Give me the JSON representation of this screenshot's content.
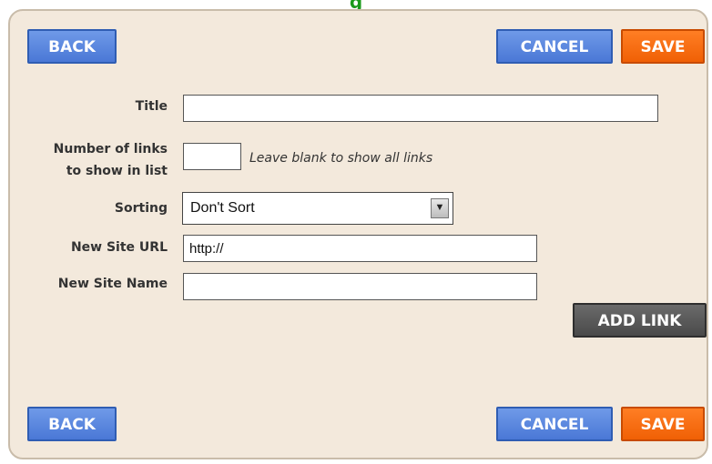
{
  "header": {
    "title_fragment": "g"
  },
  "toolbar": {
    "back_label": "BACK",
    "cancel_label": "CANCEL",
    "save_label": "SAVE"
  },
  "form": {
    "title_label": "Title",
    "title_value": "",
    "num_links_label_line1": "Number of links",
    "num_links_label_line2": "to show in list",
    "num_links_value": "",
    "num_links_hint": "Leave blank to show all links",
    "sorting_label": "Sorting",
    "sorting_selected": "Don't Sort",
    "new_site_url_label": "New Site URL",
    "new_site_url_value": "http://",
    "new_site_name_label": "New Site Name",
    "new_site_name_value": "",
    "add_link_label": "ADD LINK"
  },
  "footer": {
    "back_label": "BACK",
    "cancel_label": "CANCEL",
    "save_label": "SAVE"
  },
  "colors": {
    "panel_bg": "#f3e9dc",
    "blue_button": "#5a86df",
    "orange_button": "#f26a0f",
    "dark_button": "#555555",
    "title_green": "#1a9a1a"
  }
}
